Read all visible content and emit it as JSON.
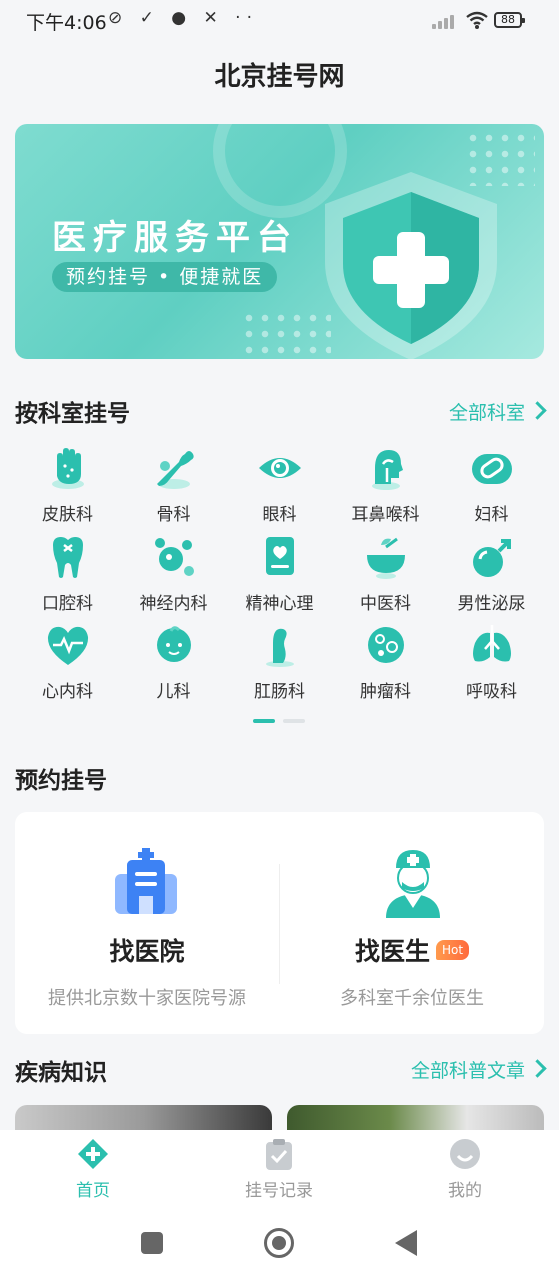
{
  "status_bar": {
    "time": "下午4:06",
    "left_icons": "⊘ ✓ ● ✕ ··",
    "battery": "88"
  },
  "header": {
    "title": "北京挂号网"
  },
  "banner": {
    "title": "医疗服务平台",
    "subtitle": "预约挂号 • 便捷就医"
  },
  "departments": {
    "title": "按科室挂号",
    "link": "全部科室",
    "items": [
      {
        "label": "皮肤科",
        "icon": "skin-hand-icon"
      },
      {
        "label": "骨科",
        "icon": "bone-icon"
      },
      {
        "label": "眼科",
        "icon": "eye-icon"
      },
      {
        "label": "耳鼻喉科",
        "icon": "ent-head-icon"
      },
      {
        "label": "妇科",
        "icon": "gynecology-icon"
      },
      {
        "label": "口腔科",
        "icon": "tooth-icon"
      },
      {
        "label": "神经内科",
        "icon": "neuron-icon"
      },
      {
        "label": "精神心理",
        "icon": "mental-heart-icon"
      },
      {
        "label": "中医科",
        "icon": "herbal-bowl-icon"
      },
      {
        "label": "男性泌尿",
        "icon": "male-icon"
      },
      {
        "label": "心内科",
        "icon": "heart-pulse-icon"
      },
      {
        "label": "儿科",
        "icon": "baby-icon"
      },
      {
        "label": "肛肠科",
        "icon": "anorectal-icon"
      },
      {
        "label": "肿瘤科",
        "icon": "tumor-cell-icon"
      },
      {
        "label": "呼吸科",
        "icon": "lungs-icon"
      }
    ],
    "page": 1,
    "pages": 2
  },
  "booking": {
    "title": "预约挂号",
    "hospital": {
      "title": "找医院",
      "subtitle": "提供北京数十家医院号源",
      "icon": "hospital-building-icon"
    },
    "doctor": {
      "title": "找医生",
      "badge": "Hot",
      "subtitle": "多科室千余位医生",
      "icon": "doctor-icon"
    }
  },
  "knowledge": {
    "title": "疾病知识",
    "link": "全部科普文章"
  },
  "bottom_nav": [
    {
      "label": "首页",
      "icon": "home-plus-icon",
      "active": true
    },
    {
      "label": "挂号记录",
      "icon": "clipboard-check-icon",
      "active": false
    },
    {
      "label": "我的",
      "icon": "profile-icon",
      "active": false
    }
  ],
  "colors": {
    "accent": "#2bbfae",
    "accent_dark": "#1aa394",
    "background": "#f5f6f8"
  }
}
